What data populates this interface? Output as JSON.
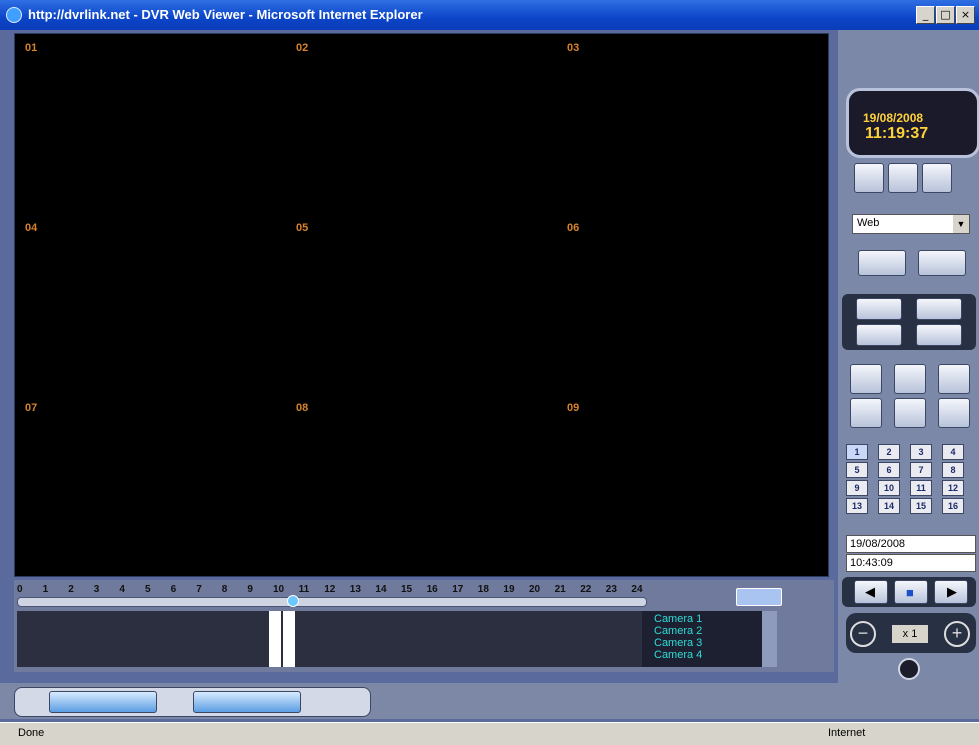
{
  "window": {
    "title": "http://dvrlink.net - DVR Web Viewer - Microsoft Internet Explorer"
  },
  "cameras": [
    {
      "label": "01"
    },
    {
      "label": "02"
    },
    {
      "label": "03"
    },
    {
      "label": "04"
    },
    {
      "label": "05"
    },
    {
      "label": "06"
    },
    {
      "label": "07"
    },
    {
      "label": "08"
    },
    {
      "label": "09"
    }
  ],
  "timeline": {
    "hours": [
      "0",
      "1",
      "2",
      "3",
      "4",
      "5",
      "6",
      "7",
      "8",
      "9",
      "10",
      "11",
      "12",
      "13",
      "14",
      "15",
      "16",
      "17",
      "18",
      "19",
      "20",
      "21",
      "22",
      "23",
      "24"
    ],
    "cameras": [
      "Camera 1",
      "Camera 2",
      "Camera 3",
      "Camera 4"
    ]
  },
  "clock": {
    "date": "19/08/2008",
    "time": "11:19:37"
  },
  "mode_select": {
    "value": "Web"
  },
  "channels": [
    "1",
    "2",
    "3",
    "4",
    "5",
    "6",
    "7",
    "8",
    "9",
    "10",
    "11",
    "12",
    "13",
    "14",
    "15",
    "16"
  ],
  "search": {
    "date": "19/08/2008",
    "time": "10:43:09"
  },
  "playback": {
    "speed": "x 1"
  },
  "status": {
    "left": "Done",
    "zone": "Internet"
  },
  "colors": {
    "accent": "#0c45c9",
    "camera_label": "#d6822c",
    "camera_list": "#2fdcd8",
    "clock_text": "#ffd23a"
  }
}
